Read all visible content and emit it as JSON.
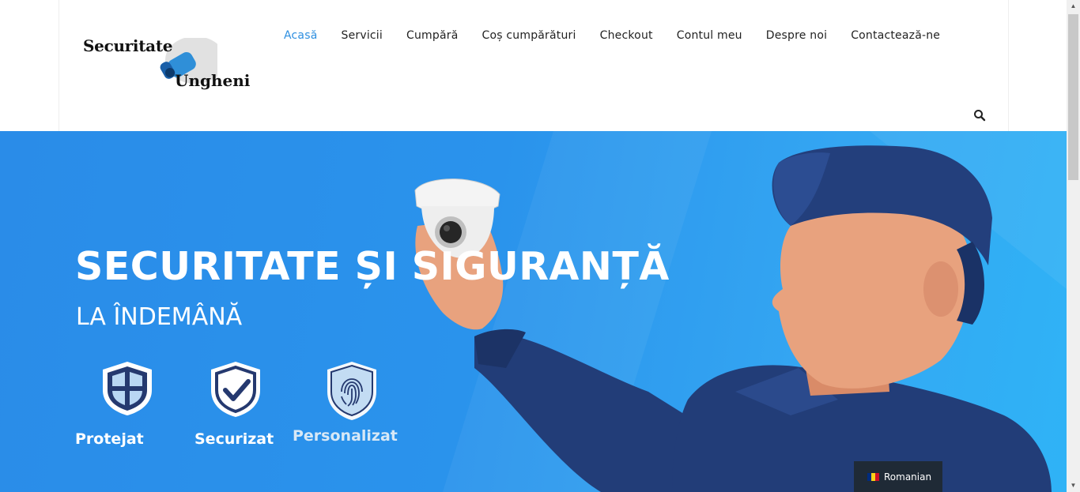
{
  "logo": {
    "line1": "Securitate",
    "line2": "Ungheni"
  },
  "nav": {
    "items": [
      {
        "label": "Acasă",
        "active": true
      },
      {
        "label": "Servicii"
      },
      {
        "label": "Cumpără"
      },
      {
        "label": "Coș cumpărături"
      },
      {
        "label": "Checkout"
      },
      {
        "label": "Contul meu"
      },
      {
        "label": "Despre noi"
      },
      {
        "label": "Contactează-ne"
      }
    ],
    "search_icon": "search-icon"
  },
  "hero": {
    "title": "SECURITATE ȘI SIGURANȚĂ",
    "subtitle": "LA ÎNDEMÂNĂ",
    "features": [
      {
        "label": "Protejat",
        "icon": "shield-grid-icon"
      },
      {
        "label": "Securizat",
        "icon": "shield-check-icon"
      },
      {
        "label": "Personalizat",
        "icon": "shield-fingerprint-icon"
      }
    ]
  },
  "language": {
    "label": "Romanian",
    "flag_colors": [
      "#002b7f",
      "#fcd116",
      "#ce1126"
    ]
  },
  "colors": {
    "accent": "#2e8fe0",
    "hero_blue": "#2a8ce8",
    "uniform": "#223d78"
  }
}
